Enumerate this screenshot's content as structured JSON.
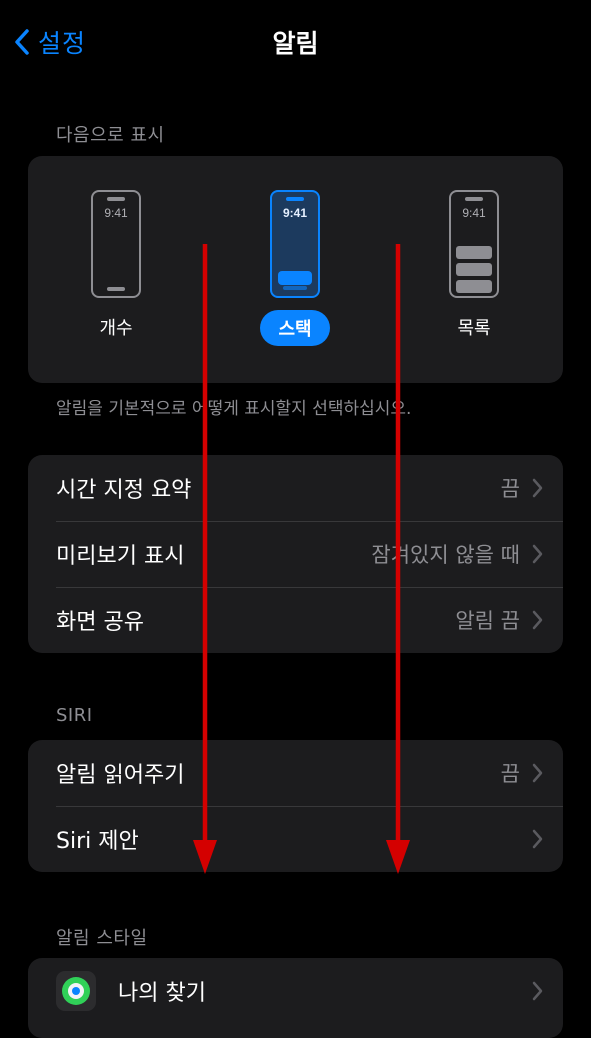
{
  "nav": {
    "back_label": "설정",
    "title": "알림"
  },
  "display_as": {
    "header": "다음으로 표시",
    "options": [
      {
        "label": "개수",
        "time": "9:41",
        "selected": false
      },
      {
        "label": "스택",
        "time": "9:41",
        "selected": true
      },
      {
        "label": "목록",
        "time": "9:41",
        "selected": false
      }
    ],
    "footnote": "알림을 기본적으로 어떻게 표시할지 선택하십시오."
  },
  "general_rows": [
    {
      "label": "시간 지정 요약",
      "value": "끔"
    },
    {
      "label": "미리보기 표시",
      "value": "잠겨있지 않을 때"
    },
    {
      "label": "화면 공유",
      "value": "알림 끔"
    }
  ],
  "siri": {
    "header": "SIRI",
    "rows": [
      {
        "label": "알림 읽어주기",
        "value": "끔"
      },
      {
        "label": "Siri 제안",
        "value": ""
      }
    ]
  },
  "notification_style": {
    "header": "알림 스타일",
    "apps": [
      {
        "label": "나의 찾기",
        "icon": "find-my-icon"
      }
    ]
  },
  "colors": {
    "accent": "#0a84ff",
    "annotation_arrow": "#d40000",
    "card_bg": "#1c1c1e"
  }
}
